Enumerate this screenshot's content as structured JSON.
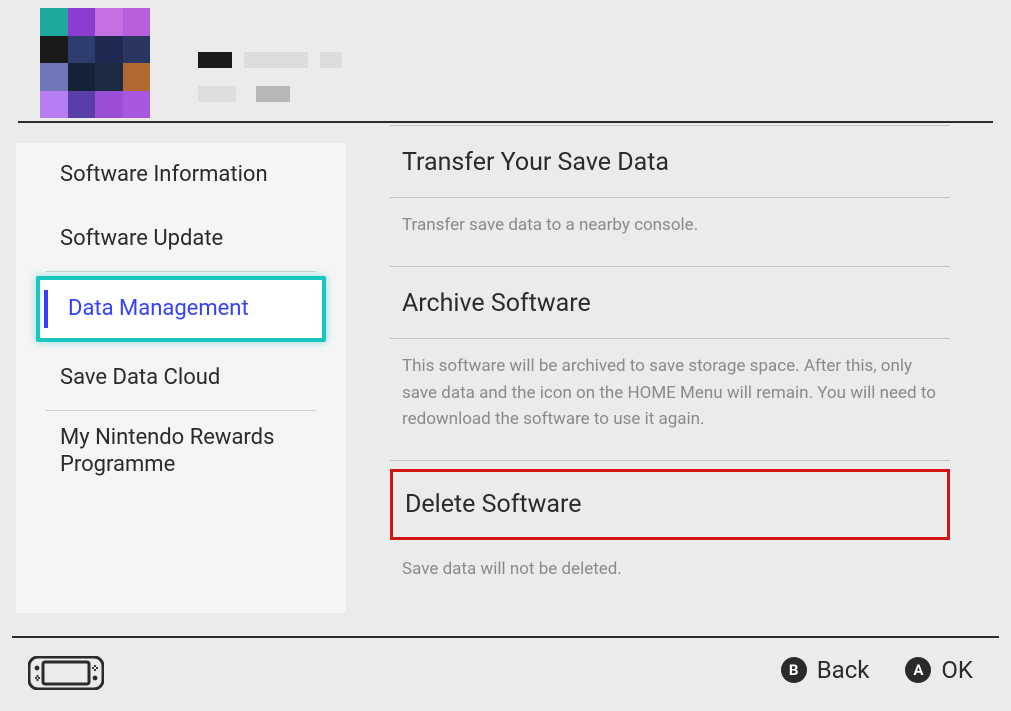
{
  "sidebar": {
    "items": [
      {
        "label": "Software Information"
      },
      {
        "label": "Software Update"
      },
      {
        "label": "Data Management",
        "selected": true
      },
      {
        "label": "Save Data Cloud"
      },
      {
        "label": "My Nintendo Rewards Programme"
      }
    ]
  },
  "content": {
    "transfer": {
      "title": "Transfer Your Save Data",
      "desc": "Transfer save data to a nearby console."
    },
    "archive": {
      "title": "Archive Software",
      "desc": "This software will be archived to save storage space. After this, only save data and the icon on the HOME Menu will remain. You will need to redownload the software to use it again."
    },
    "delete": {
      "title": "Delete Software",
      "desc": "Save data will not be deleted."
    }
  },
  "footer": {
    "back_button": "B",
    "back_label": "Back",
    "ok_button": "A",
    "ok_label": "OK"
  },
  "icon_palette": [
    "#20a89e",
    "#8b3dd1",
    "#c46fe0",
    "#b85fdb",
    "#1a1a1a",
    "#2d3e6e",
    "#1f2850",
    "#2a3560",
    "#6f77b8",
    "#152238",
    "#1c2a42",
    "#b06a30",
    "#b57df0",
    "#5a3ea8",
    "#9a4fd6",
    "#a858df"
  ]
}
